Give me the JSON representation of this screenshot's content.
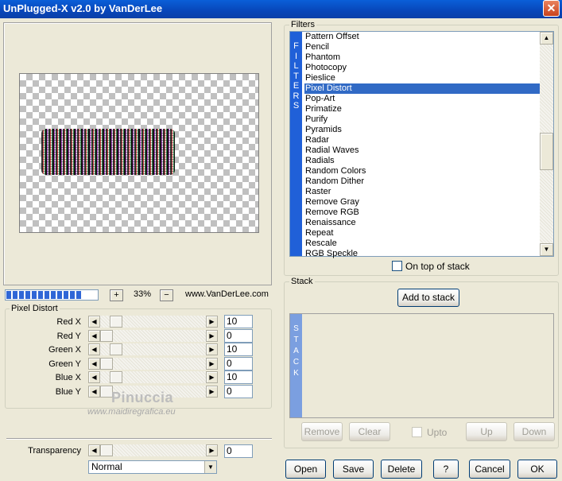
{
  "window": {
    "title": "UnPlugged-X v2.0 by VanDerLee",
    "close_glyph": "✕"
  },
  "preview": {
    "zoom": "33%",
    "zoom_in": "+",
    "zoom_out": "−",
    "website": "www.VanDerLee.com",
    "progress_segments": 12
  },
  "pixel_distort": {
    "legend": "Pixel Distort",
    "sliders": [
      {
        "label": "Red X",
        "value": "10",
        "thumb": true
      },
      {
        "label": "Red Y",
        "value": "0",
        "thumb": false
      },
      {
        "label": "Green X",
        "value": "10",
        "thumb": true
      },
      {
        "label": "Green Y",
        "value": "0",
        "thumb": false
      },
      {
        "label": "Blue X",
        "value": "10",
        "thumb": true
      },
      {
        "label": "Blue Y",
        "value": "0",
        "thumb": false
      }
    ]
  },
  "watermark": {
    "name": "Pinuccia",
    "site": "www.maidiregrafica.eu"
  },
  "transparency": {
    "label": "Transparency",
    "value": "0"
  },
  "blend_mode": {
    "selected": "Normal"
  },
  "filters": {
    "legend": "Filters",
    "side_label": "FILTERS",
    "items": [
      "Pattern Offset",
      "Pencil",
      "Phantom",
      "Photocopy",
      "Pieslice",
      "Pixel Distort",
      "Pop-Art",
      "Primatize",
      "Purify",
      "Pyramids",
      "Radar",
      "Radial Waves",
      "Radials",
      "Random Colors",
      "Random Dither",
      "Raster",
      "Remove Gray",
      "Remove RGB",
      "Renaissance",
      "Repeat",
      "Rescale",
      "RGB Speckle"
    ],
    "selected": "Pixel Distort",
    "on_top_label": "On top of stack"
  },
  "stack": {
    "legend": "Stack",
    "add_label": "Add to stack",
    "side_label": "STACK",
    "remove_label": "Remove",
    "clear_label": "Clear",
    "upto_label": "Upto",
    "up_label": "Up",
    "down_label": "Down"
  },
  "footer": {
    "open": "Open",
    "save": "Save",
    "delete": "Delete",
    "help": "?",
    "cancel": "Cancel",
    "ok": "OK"
  },
  "colors": {
    "title_bar": "#0846b9",
    "selection": "#316ac5",
    "filters_side": "#2060d8",
    "stack_side": "#7b9fe0"
  }
}
